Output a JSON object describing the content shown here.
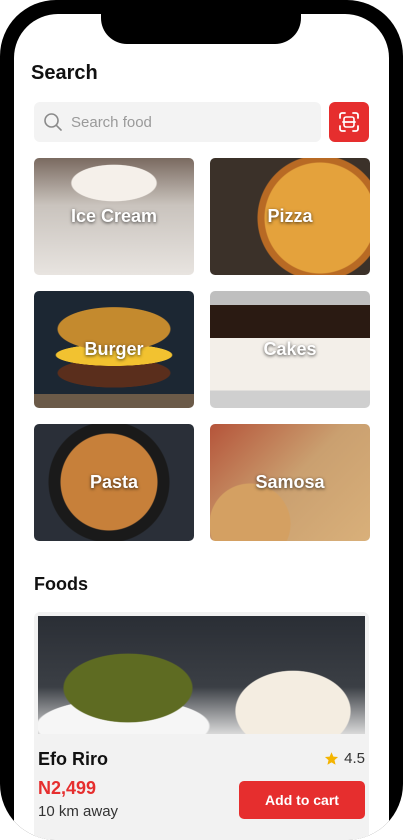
{
  "header": {
    "title": "Search"
  },
  "search": {
    "placeholder": "Search food",
    "scan_icon": "scan-icon",
    "search_icon": "search-icon"
  },
  "categories": [
    {
      "label": "Ice Cream"
    },
    {
      "label": "Pizza"
    },
    {
      "label": "Burger"
    },
    {
      "label": "Cakes"
    },
    {
      "label": "Pasta"
    },
    {
      "label": "Samosa"
    }
  ],
  "foods": {
    "title": "Foods",
    "items": [
      {
        "name": "Efo Riro",
        "rating": "4.5",
        "price": "N2,499",
        "distance": "10 km away",
        "button": "Add to cart"
      }
    ]
  },
  "colors": {
    "accent": "#e62e2e",
    "star": "#f4b400"
  }
}
